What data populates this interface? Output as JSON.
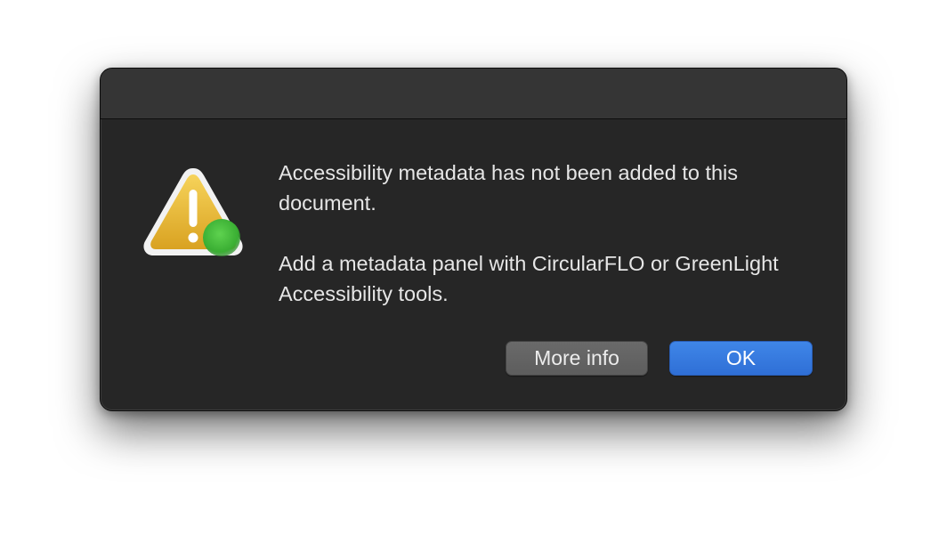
{
  "dialog": {
    "icon": "warning-triangle-icon",
    "badge_icon": "green-dot-icon",
    "message": "Accessibility metadata has not been added to this document.",
    "informative_text": "Add a metadata panel with CircularFLO or GreenLight Accessibility tools.",
    "buttons": {
      "secondary_label": "More info",
      "primary_label": "OK"
    }
  },
  "colors": {
    "dialog_background": "#262626",
    "titlebar_background": "#353535",
    "primary_button": "#3478e0",
    "secondary_button": "#636363",
    "warning_yellow": "#e9b531",
    "badge_green": "#3fbf3a"
  }
}
